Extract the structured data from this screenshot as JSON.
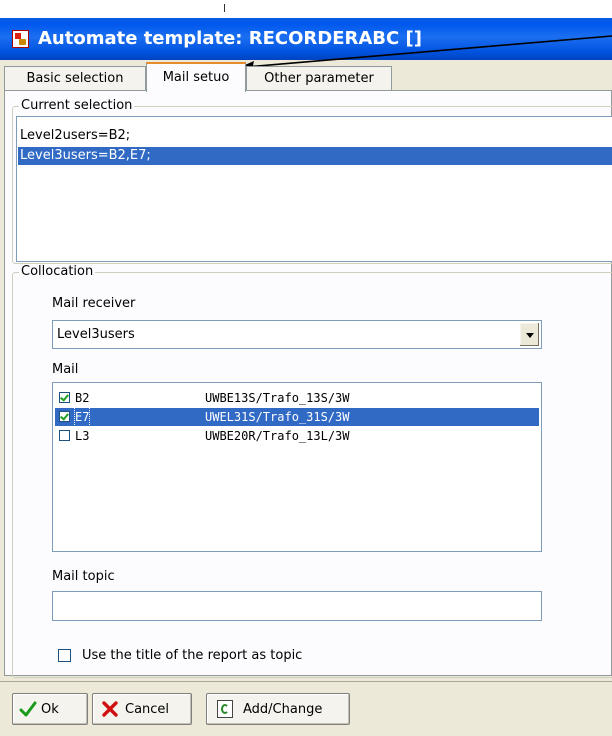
{
  "window": {
    "title": "Automate template: RECORDERABC []"
  },
  "tabs": [
    {
      "label": "Basic selection"
    },
    {
      "label": "Mail setuo"
    },
    {
      "label": "Other parameter"
    }
  ],
  "current_selection": {
    "label": "Current selection",
    "items": [
      "Level2users=B2;",
      "Level3users=B2,E7;"
    ],
    "selected_index": 1
  },
  "collocation": {
    "label": "Collocation",
    "mail_receiver_label": "Mail receiver",
    "mail_receiver_value": "Level3users",
    "mail_label": "Mail",
    "mail_rows": [
      {
        "code": "B2",
        "path": "UWBE13S/Trafo_13S/3W",
        "checked": true
      },
      {
        "code": "E7",
        "path": "UWEL31S/Trafo_31S/3W",
        "checked": true
      },
      {
        "code": "L3",
        "path": "UWBE20R/Trafo_13L/3W",
        "checked": false
      }
    ],
    "mail_topic_label": "Mail topic",
    "mail_topic_value": "",
    "use_title_label": "Use the title of the report as topic"
  },
  "buttons": {
    "ok": "Ok",
    "cancel": "Cancel",
    "add_change": "Add/Change"
  },
  "colors": {
    "title_bar": "#0058ee",
    "selection": "#316ac5",
    "active_tab_accent": "#e68b2c"
  }
}
